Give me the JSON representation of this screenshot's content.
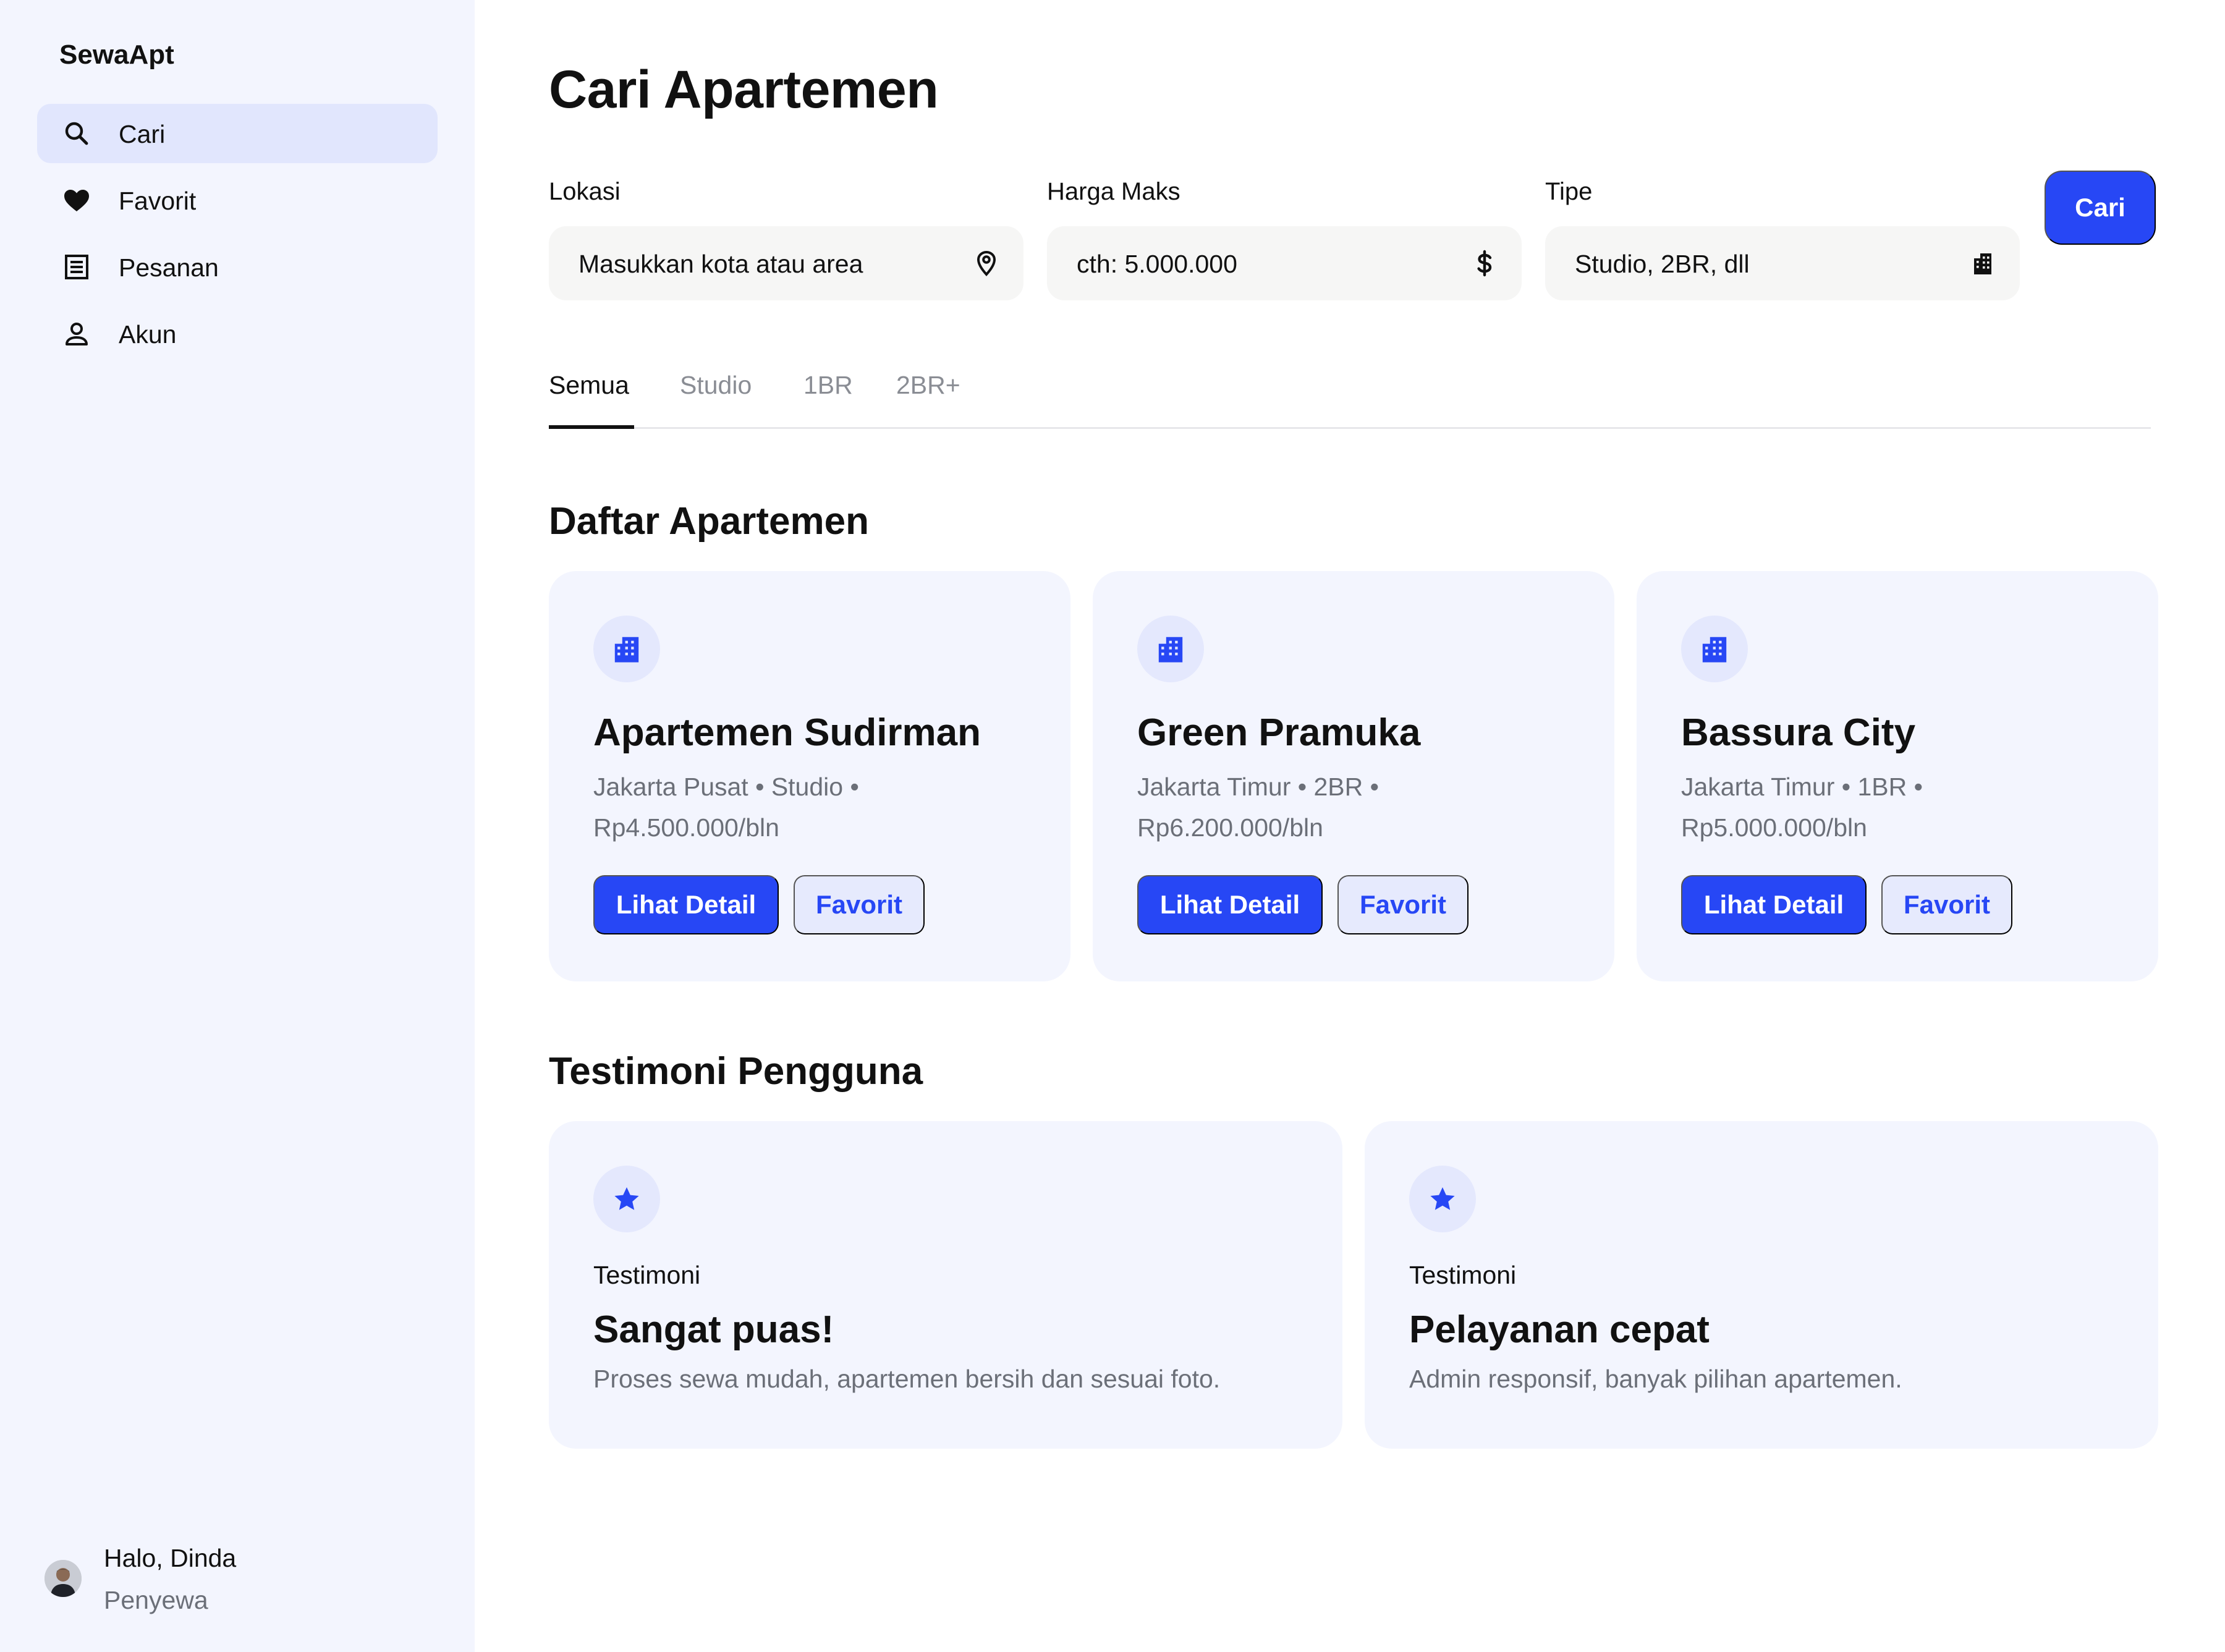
{
  "app": {
    "brand": "SewaApt"
  },
  "sidebar": {
    "items": [
      {
        "label": "Cari",
        "icon": "search-icon",
        "active": true
      },
      {
        "label": "Favorit",
        "icon": "heart-icon",
        "active": false
      },
      {
        "label": "Pesanan",
        "icon": "receipt-icon",
        "active": false
      },
      {
        "label": "Akun",
        "icon": "person-icon",
        "active": false
      }
    ],
    "user": {
      "greeting": "Halo, Dinda",
      "role": "Penyewa"
    }
  },
  "main": {
    "title": "Cari Apartemen",
    "filters": [
      {
        "label": "Lokasi",
        "placeholder": "Masukkan kota atau area",
        "icon": "location-pin-icon"
      },
      {
        "label": "Harga Maks",
        "placeholder": "cth: 5.000.000",
        "icon": "dollar-icon"
      },
      {
        "label": "Tipe",
        "placeholder": "Studio, 2BR, dll",
        "icon": "building-icon"
      }
    ],
    "search_button": "Cari",
    "tabs": [
      {
        "label": "Semua",
        "active": true
      },
      {
        "label": "Studio",
        "active": false
      },
      {
        "label": "1BR",
        "active": false
      },
      {
        "label": "2BR+",
        "active": false
      }
    ],
    "listings_title": "Daftar Apartemen",
    "listings": [
      {
        "name": "Apartemen Sudirman",
        "meta": "Jakarta Pusat • Studio • Rp4.500.000/bln",
        "detail_label": "Lihat Detail",
        "favorite_label": "Favorit"
      },
      {
        "name": "Green Pramuka",
        "meta": "Jakarta Timur • 2BR • Rp6.200.000/bln",
        "detail_label": "Lihat Detail",
        "favorite_label": "Favorit"
      },
      {
        "name": "Bassura City",
        "meta": "Jakarta Timur • 1BR • Rp5.000.000/bln",
        "detail_label": "Lihat Detail",
        "favorite_label": "Favorit"
      }
    ],
    "testimonials_title": "Testimoni Pengguna",
    "testimonials": [
      {
        "kicker": "Testimoni",
        "title": "Sangat puas!",
        "text": "Proses sewa mudah, apartemen bersih dan sesuai foto."
      },
      {
        "kicker": "Testimoni",
        "title": "Pelayanan cepat",
        "text": "Admin responsif, banyak pilihan apartemen."
      }
    ]
  },
  "colors": {
    "accent": "#2747f5",
    "sidebar_bg": "#f3f5fe",
    "active_nav_bg": "#e1e6fd",
    "card_bg": "#f3f5fe",
    "input_bg": "#f6f6f5",
    "muted_text": "#6b6f78"
  }
}
